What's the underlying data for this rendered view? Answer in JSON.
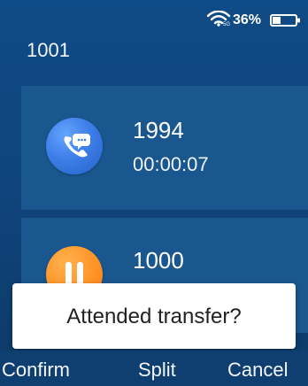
{
  "status_bar": {
    "battery_percent": "36%",
    "wifi_icon": "wifi-icon",
    "battery_icon": "battery-icon",
    "battery_level": 0.36
  },
  "account": {
    "number": "1001"
  },
  "calls": [
    {
      "number": "1994",
      "duration": "00:00:07",
      "status_icon": "phone-chat-icon",
      "avatar_color": "#3e7ee8"
    },
    {
      "number": "1000",
      "status_icon": "pause-icon",
      "avatar_color": "#ff9326"
    }
  ],
  "dialog": {
    "message": "Attended transfer?"
  },
  "softkeys": {
    "confirm": "Confirm",
    "split": "Split",
    "cancel": "Cancel"
  },
  "colors": {
    "background": "#0f447c",
    "card": "#1a578f",
    "dialog": "#ffffff"
  }
}
